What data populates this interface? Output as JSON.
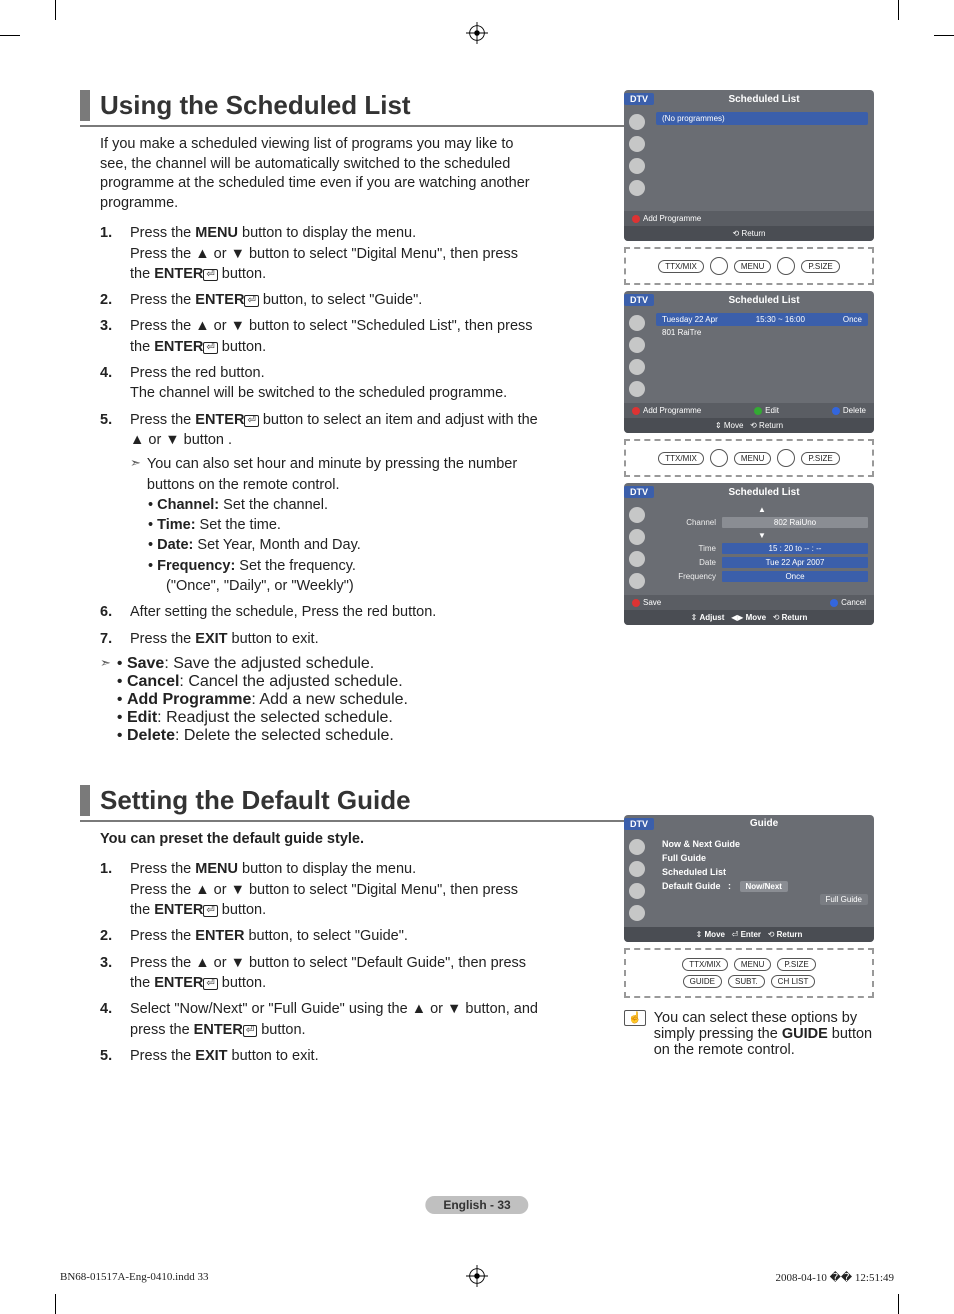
{
  "section1": {
    "title": "Using the Scheduled List",
    "intro": "If you make a scheduled viewing list of programs you may like to see, the channel will be automatically switched to the scheduled programme at the scheduled time even if you are watching another programme.",
    "steps": {
      "1a": "Press the ",
      "1b": "MENU",
      "1c": " button to display the menu.",
      "1d": "Press the ▲ or ▼ button to select \"Digital Menu\", then press the ",
      "1e": "ENTER",
      "1f": " button.",
      "2a": "Press the ",
      "2b": "ENTER",
      "2c": " button, to select \"Guide\".",
      "3a": "Press the ▲ or ▼ button to select \"Scheduled List\", then press the ",
      "3b": "ENTER",
      "3c": " button.",
      "4a": "Press the red button.",
      "4b": "The channel will be switched to the scheduled programme.",
      "5a": "Press the ",
      "5b": "ENTER",
      "5c": " button to select an item and adjust with the ▲ or ▼ button .",
      "5note": "You can also set hour and minute by pressing the number buttons on the remote control.",
      "5ch_l": "Channel:",
      "5ch_t": " Set the channel.",
      "5tm_l": "Time:",
      "5tm_t": " Set the time.",
      "5dt_l": "Date:",
      "5dt_t": " Set Year, Month and Day.",
      "5fq_l": "Frequency:",
      "5fq_t": " Set the frequency.",
      "5fq2": "(\"Once\", \"Daily\", or \"Weekly\")",
      "6": "After setting the schedule, Press the red button.",
      "7a": "Press the ",
      "7b": "EXIT",
      "7c": " button to exit.",
      "sv_l": "Save",
      "sv_t": ": Save the adjusted schedule.",
      "cn_l": "Cancel",
      "cn_t": ": Cancel the adjusted schedule.",
      "ap_l": "Add Programme",
      "ap_t": ": Add a new schedule.",
      "ed_l": "Edit",
      "ed_t": ": Readjust the selected schedule.",
      "de_l": "Delete",
      "de_t": ": Delete the selected schedule."
    }
  },
  "section2": {
    "title": "Setting the Default Guide",
    "intro": "You can preset the default guide style.",
    "steps": {
      "1a": "Press the ",
      "1b": "MENU",
      "1c": " button to display the menu.",
      "1d": "Press the ▲ or ▼ button to select \"Digital Menu\", then press the ",
      "1e": "ENTER",
      "1f": " button.",
      "2a": "Press the ",
      "2b": "ENTER",
      "2c": " button, to select \"Guide\".",
      "3a": "Press the ▲ or ▼ button to select \"Default Guide\", then press the ",
      "3b": "ENTER",
      "3c": " button.",
      "4a": "Select \"Now/Next\" or \"Full Guide\" using the ▲ or ▼ button, and press the ",
      "4b": "ENTER",
      "4c": " button.",
      "5a": "Press the ",
      "5b": "EXIT",
      "5c": " button to exit."
    },
    "tip": "You can select these options by simply pressing the ",
    "tip_b": "GUIDE",
    "tip2": " button on the remote control."
  },
  "shots": {
    "dtv": "DTV",
    "sched_title": "Scheduled List",
    "noprog": "(No programmes)",
    "addprog": "Add Programme",
    "return": "Return",
    "row_date": "Tuesday  22  Apr",
    "row_time": "15:30 ~ 16:00",
    "row_freq": "Once",
    "row_ch": "801  RaiTre",
    "edit": "Edit",
    "delete": "Delete",
    "move": "Move",
    "adjust": "Adjust",
    "channel_l": "Channel",
    "channel_v": "802 RaiUno",
    "time_l": "Time",
    "time_v": "15 : 20 to -- : --",
    "date_l": "Date",
    "date_v": "Tue 22 Apr 2007",
    "freq_l": "Frequency",
    "freq_v": "Once",
    "save": "Save",
    "cancel": "Cancel",
    "guide_title": "Guide",
    "g1": "Now & Next Guide",
    "g2": "Full Guide",
    "g3": "Scheduled List",
    "g4": "Default Guide",
    "sel1": "Now/Next",
    "sel2": "Full Guide",
    "enter": "Enter",
    "ttx": "TTX/MIX",
    "menu": "MENU",
    "psize": "P.SIZE",
    "guidebtn": "GUIDE",
    "subt": "SUBT.",
    "chlist": "CH LIST"
  },
  "page_label": "English - 33",
  "footer_left": "BN68-01517A-Eng-0410.indd   33",
  "footer_right": "2008-04-10   �� 12:51:49"
}
